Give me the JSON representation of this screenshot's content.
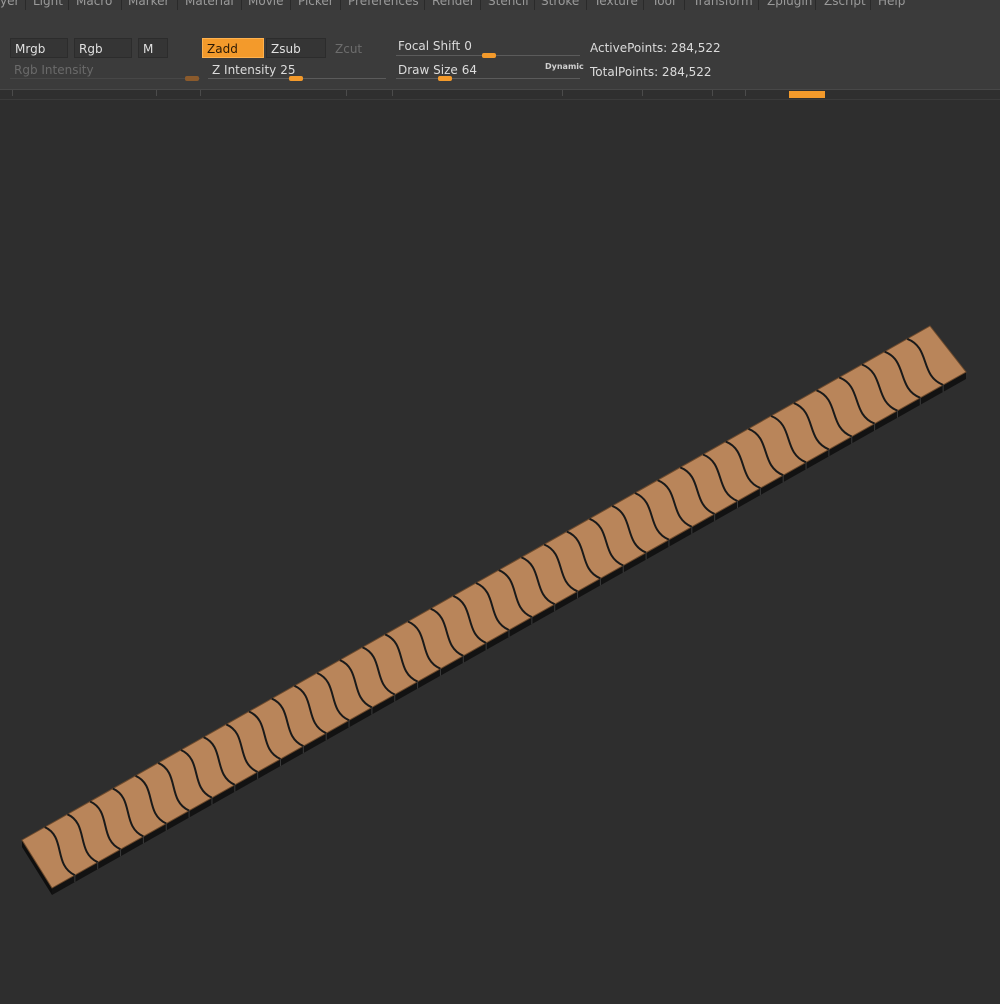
{
  "menu": {
    "items": [
      "yer",
      "Light",
      "Macro",
      "Marker",
      "Material",
      "Movie",
      "Picker",
      "Preferences",
      "Render",
      "Stencil",
      "Stroke",
      "Texture",
      "Tool",
      "Transform",
      "Zplugin",
      "Zscript",
      "Help"
    ]
  },
  "toolbar": {
    "mrgb": "Mrgb",
    "rgb": "Rgb",
    "m": "M",
    "zadd": "Zadd",
    "zsub": "Zsub",
    "zcut": "Zcut",
    "rgb_intensity_label": "Rgb Intensity",
    "z_intensity_label": "Z Intensity",
    "z_intensity_value": "25",
    "focal_shift_label": "Focal Shift",
    "focal_shift_value": "0",
    "draw_size_label": "Draw Size",
    "draw_size_value": "64",
    "dynamic_label": "Dynamic",
    "active_points": "ActivePoints: 284,522",
    "total_points": "TotalPoints: 284,522"
  },
  "colors": {
    "accent": "#f39a2b",
    "model_fill": "#b9855a",
    "model_edge": "#1a1a1a",
    "background": "#2e2e2e"
  },
  "model": {
    "segments": 40
  }
}
